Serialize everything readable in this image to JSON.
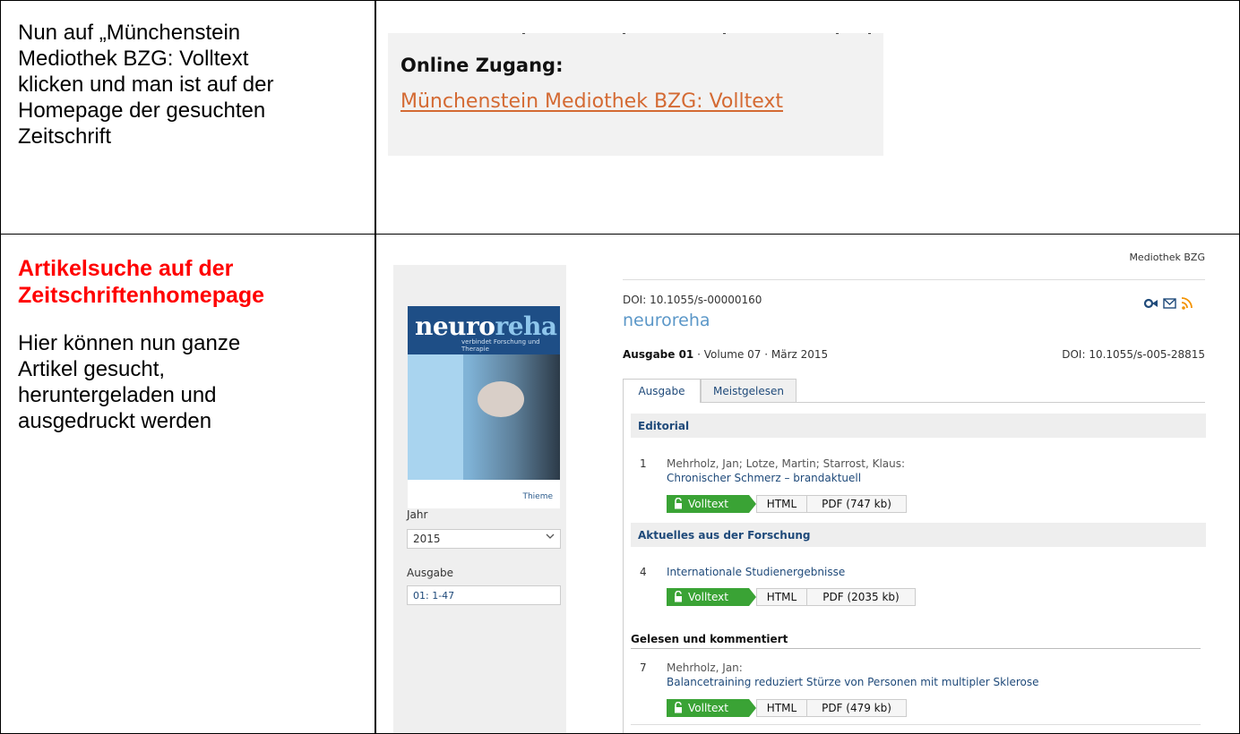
{
  "row1": {
    "instruction": "Nun auf „Münchenstein Mediothek BZG: Volltext klicken und man ist auf der Homepage der gesuchten Zeitschrift",
    "instruction_lines": [
      "Nun auf „Münchenstein",
      "Mediothek BZG: Volltext",
      "klicken und man ist auf der",
      "Homepage der gesuchten",
      "Zeitschrift"
    ],
    "screenshot": {
      "heading": "Online Zugang:",
      "link": "Münchenstein Mediothek BZG: Volltext",
      "link_color": "#d46a33"
    }
  },
  "row2": {
    "heading_lines": [
      "Artikelsuche auf der",
      "Zeitschriftenhomepage"
    ],
    "heading_color": "#ff0000",
    "body_lines": [
      "Hier können nun ganze",
      "Artikel gesucht,",
      "heruntergeladen und",
      "ausgedruckt werden"
    ],
    "screenshot": {
      "mediothek": "Mediothek BZG",
      "cover": {
        "brand_a": "neuro",
        "brand_b": "reha",
        "sub": "verbindet Forschung und Therapie",
        "publisher": "Thieme"
      },
      "sidebar": {
        "year_label": "Jahr",
        "year_value": "2015",
        "issue_label": "Ausgabe",
        "issue_value": "01: 1-47"
      },
      "doi_journal": "DOI: 10.1055/s-00000160",
      "journal_title": "neuroreha",
      "issue_bold": "Ausgabe 01",
      "issue_rest": " · Volume 07 · März 2015",
      "doi_issue": "DOI: 10.1055/s-005-28815",
      "icons": [
        "orcid-share-icon",
        "mail-icon",
        "rss-icon"
      ],
      "tabs": [
        "Ausgabe",
        "Meistgelesen"
      ],
      "sections": [
        {
          "title": "Editorial",
          "articles": [
            {
              "num": "1",
              "authors": "Mehrholz, Jan; Lotze, Martin; Starrost, Klaus:",
              "title": "Chronischer Schmerz – brandaktuell",
              "fulltext": "Volltext",
              "html": "HTML",
              "pdf": "PDF (747 kb)"
            }
          ]
        },
        {
          "title": "Aktuelles aus der Forschung",
          "articles": [
            {
              "num": "4",
              "authors": "",
              "title": "Internationale Studienergebnisse",
              "fulltext": "Volltext",
              "html": "HTML",
              "pdf": "PDF (2035 kb)"
            }
          ]
        },
        {
          "title": "Gelesen und kommentiert",
          "articles": [
            {
              "num": "7",
              "authors": "Mehrholz, Jan:",
              "title": "Balancetraining reduziert Stürze von Personen mit multipler Sklerose",
              "fulltext": "Volltext",
              "html": "HTML",
              "pdf": "PDF (479 kb)"
            }
          ]
        }
      ],
      "colors": {
        "accent_green": "#3aa335",
        "link_blue": "#1f4a7a",
        "journal_blue": "#5b97c8",
        "rss_orange": "#f39200"
      }
    }
  }
}
